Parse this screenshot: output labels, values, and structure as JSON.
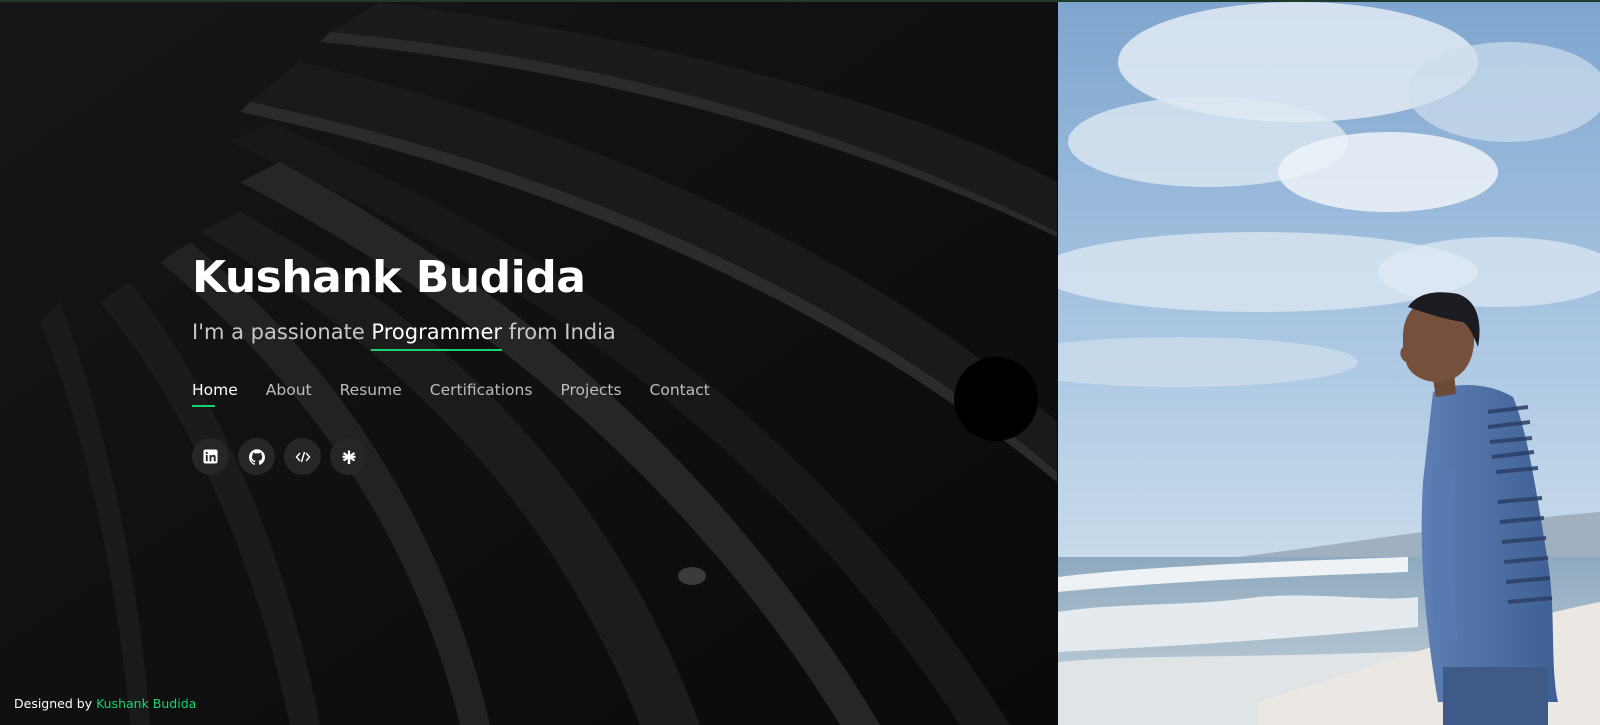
{
  "hero": {
    "name": "Kushank Budida",
    "tagline_prefix": "I'm a passionate ",
    "tagline_typed": "Programmer",
    "tagline_suffix": " from India"
  },
  "nav": {
    "items": [
      {
        "label": "Home",
        "active": true
      },
      {
        "label": "About"
      },
      {
        "label": "Resume"
      },
      {
        "label": "Certifications"
      },
      {
        "label": "Projects"
      },
      {
        "label": "Contact"
      }
    ]
  },
  "socials": [
    "linkedin-icon",
    "github-icon",
    "code-icon",
    "linktree-icon"
  ],
  "footer": {
    "prefix": "Designed by ",
    "author": "Kushank Budida"
  },
  "colors": {
    "accent": "#18d26e",
    "background": "#0c0c0d"
  }
}
